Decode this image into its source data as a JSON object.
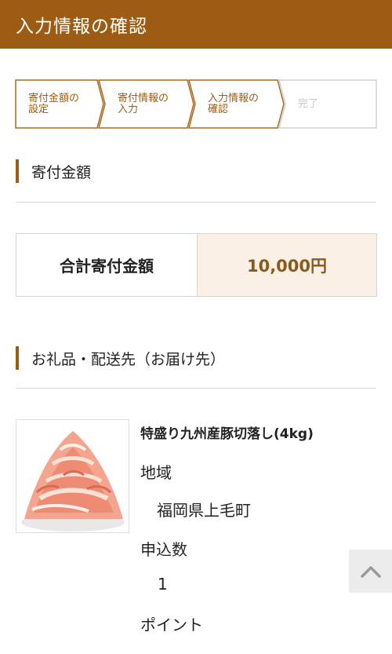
{
  "header": {
    "title": "入力情報の確認"
  },
  "steps": [
    {
      "label": "寄付金額の\n設定",
      "state": "done"
    },
    {
      "label": "寄付情報の\n入力",
      "state": "done"
    },
    {
      "label": "入力情報の\n確認",
      "state": "current"
    },
    {
      "label": "完了",
      "state": "upcoming"
    }
  ],
  "donation_section": {
    "title": "寄付金額"
  },
  "total": {
    "label": "合計寄付金額",
    "value": "10,000円"
  },
  "gift_section": {
    "title": "お礼品・配送先（お届け先）"
  },
  "product": {
    "name": "特盛り九州産豚切落し(4kg)",
    "image_icon": "sliced-pork-image",
    "region_label": "地域",
    "region_value": "福岡県上毛町",
    "quantity_label": "申込数",
    "quantity_value": "1",
    "points_label": "ポイント"
  },
  "back_to_top": {
    "icon": "chevron-up-icon"
  },
  "colors": {
    "brand": "#9c5c14",
    "total_bg": "#faf0e6",
    "total_text": "#8b5a1a"
  }
}
